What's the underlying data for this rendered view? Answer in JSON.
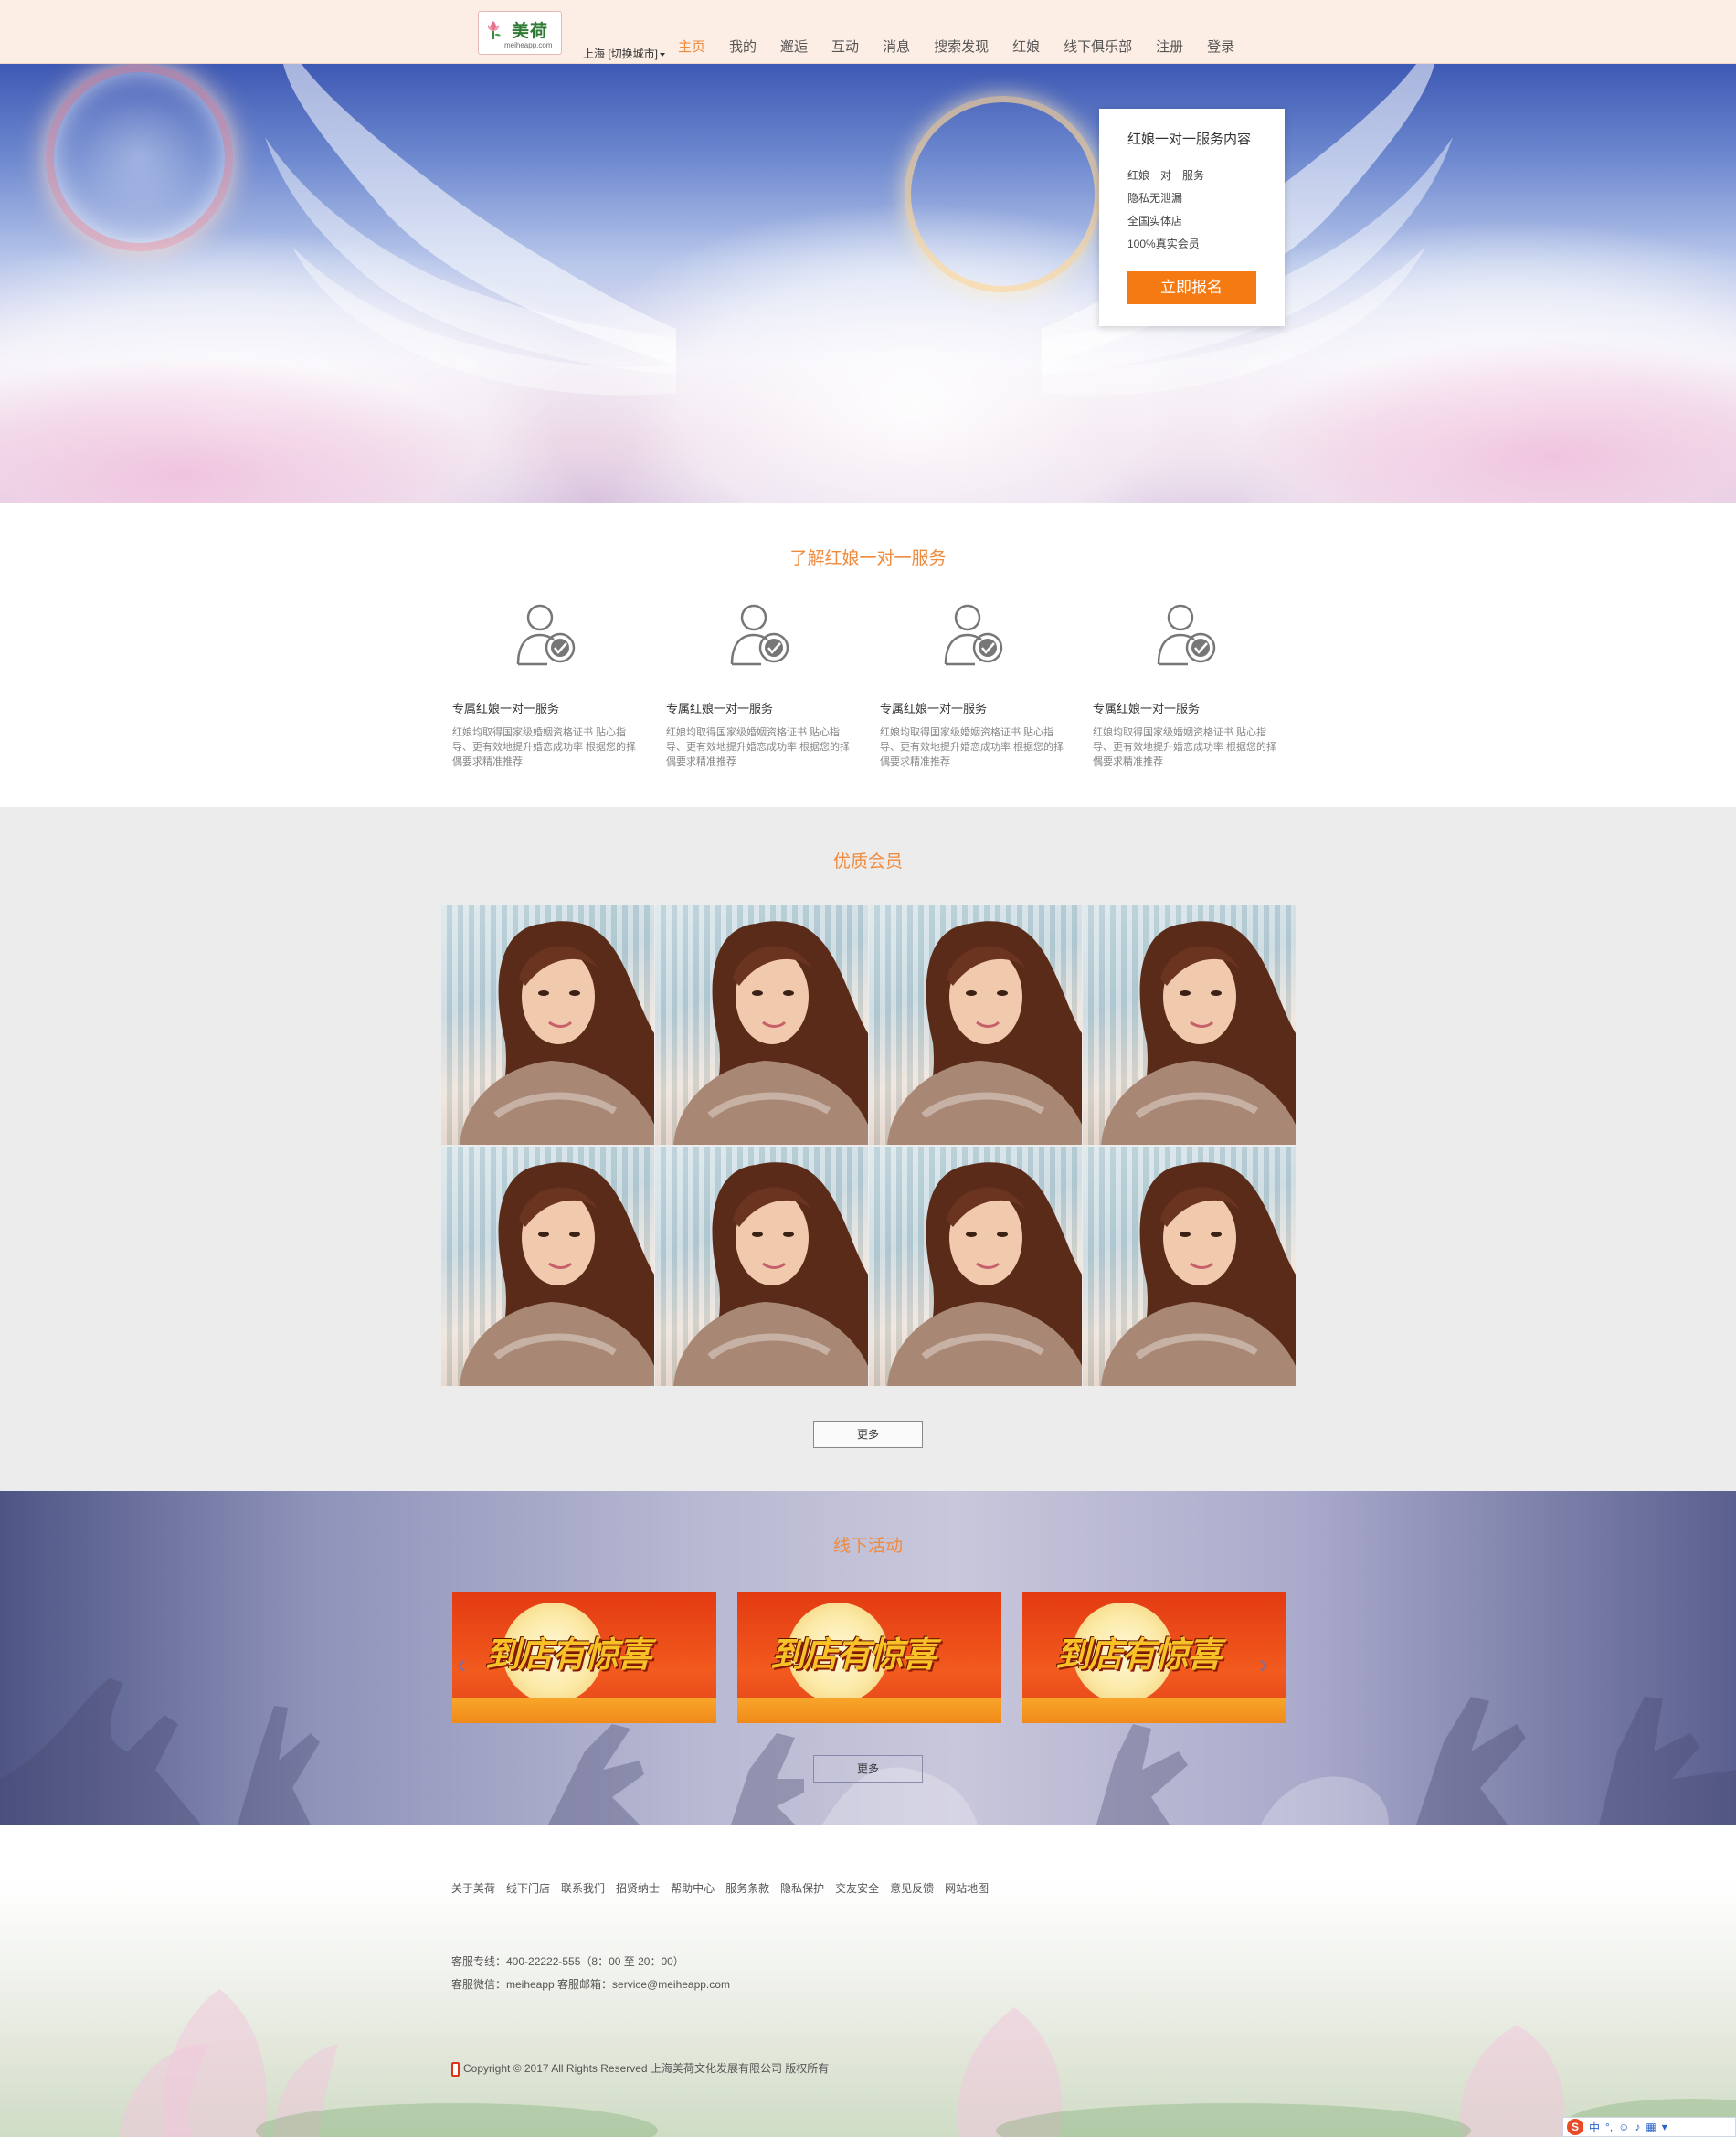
{
  "header": {
    "logo_text": "美荷",
    "logo_url": "meiheapp.com",
    "city": "上海 [切换城市]",
    "nav": [
      "主页",
      "我的",
      "邂逅",
      "互动",
      "消息",
      "搜索发现",
      "红娘",
      "线下俱乐部",
      "注册",
      "登录"
    ],
    "active_nav": "主页"
  },
  "hero": {
    "card_title": "红娘一对一服务内容",
    "card_items": [
      "红娘一对一服务",
      "隐私无泄漏",
      "全国实体店",
      "100%真实会员"
    ],
    "signup_label": "立即报名"
  },
  "services": {
    "title": "了解红娘一对一服务",
    "items": [
      {
        "title": "专属红娘一对一服务",
        "desc": "红娘均取得国家级婚姻资格证书 贴心指导、更有效地提升婚恋成功率 根据您的择偶要求精准推荐"
      },
      {
        "title": "专属红娘一对一服务",
        "desc": "红娘均取得国家级婚姻资格证书 贴心指导、更有效地提升婚恋成功率 根据您的择偶要求精准推荐"
      },
      {
        "title": "专属红娘一对一服务",
        "desc": "红娘均取得国家级婚姻资格证书 贴心指导、更有效地提升婚恋成功率 根据您的择偶要求精准推荐"
      },
      {
        "title": "专属红娘一对一服务",
        "desc": "红娘均取得国家级婚姻资格证书 贴心指导、更有效地提升婚恋成功率 根据您的择偶要求精准推荐"
      }
    ]
  },
  "members": {
    "title": "优质会员",
    "more_label": "更多"
  },
  "activities": {
    "title": "线下活动",
    "promo_text": "到店有惊喜",
    "prev_icon": "‹",
    "next_icon": "›",
    "more_label": "更多"
  },
  "footer": {
    "links": [
      "关于美荷",
      "线下门店",
      "联系我们",
      "招贤纳士",
      "帮助中心",
      "服务条款",
      "隐私保护",
      "交友安全",
      "意见反馈",
      "网站地图"
    ],
    "hotline": "客服专线：400-22222-555（8：00 至 20：00）",
    "wechat": "客服微信：meiheapp 客服邮箱：service@meiheapp.com",
    "copyright": "Copyright © 2017 All Rights Reserved 上海美荷文化发展有限公司 版权所有"
  },
  "ime": {
    "logo": "S",
    "lang": "中"
  },
  "colors": {
    "accent": "#f08a3c",
    "button_orange": "#f57a11",
    "header_bg": "#fdeee5",
    "members_bg": "#ececec"
  }
}
